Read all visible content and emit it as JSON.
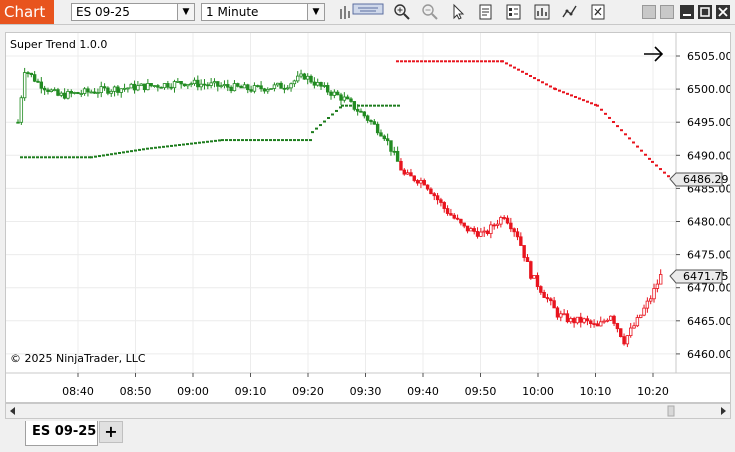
{
  "toolbar": {
    "chart_label": "Chart",
    "instrument": "ES 09-25",
    "interval": "1 Minute",
    "icons": [
      "bar-type-icon",
      "crosshair-icon",
      "zoom-in-icon",
      "zoom-out-icon",
      "pointer-icon",
      "data-box-icon",
      "properties-icon",
      "indicators-icon",
      "strategies-icon",
      "drawing-tools-icon"
    ]
  },
  "window": {
    "controls": [
      "minimize",
      "maximize",
      "close"
    ]
  },
  "chart": {
    "indicator_label": "Super Trend 1.0.0",
    "copyright": "© 2025 NinjaTrader, LLC",
    "price_labels": [
      "6505.00",
      "6500.00",
      "6495.00",
      "6490.00",
      "6485.00",
      "6480.00",
      "6475.00",
      "6470.00",
      "6465.00",
      "6460.00"
    ],
    "time_labels": [
      "08:40",
      "08:50",
      "09:00",
      "09:10",
      "09:20",
      "09:30",
      "09:40",
      "09:50",
      "10:00",
      "10:10",
      "10:20"
    ],
    "current_price": "6471.75",
    "supertrend_value": "6486.29",
    "colors": {
      "up": "#228b22",
      "down": "#e8141e",
      "supertrend_up": "#1e7d1e",
      "supertrend_down": "#e8141e"
    }
  },
  "tabs": [
    {
      "label": "ES 09-25"
    }
  ],
  "add_tab": "+"
}
